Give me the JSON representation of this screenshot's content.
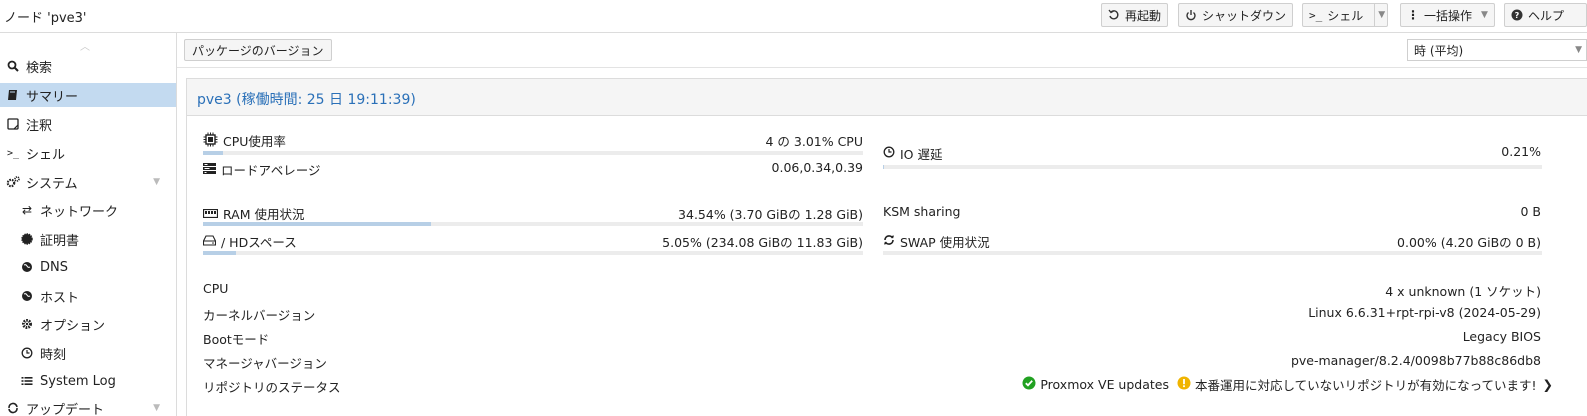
{
  "header": {
    "title": "ノード 'pve3'",
    "buttons": {
      "reboot": "再起動",
      "shutdown": "シャットダウン",
      "shell": "シェル",
      "bulk": "一括操作",
      "help": "ヘルプ"
    }
  },
  "sidebar": {
    "items": [
      {
        "label": "検索",
        "icon": "search-icon"
      },
      {
        "label": "サマリー",
        "icon": "book-icon",
        "active": true
      },
      {
        "label": "注釈",
        "icon": "note-icon"
      },
      {
        "label": "シェル",
        "icon": "terminal-icon"
      },
      {
        "label": "システム",
        "icon": "gears-icon"
      },
      {
        "label": "ネットワーク",
        "icon": "exchange-icon"
      },
      {
        "label": "証明書",
        "icon": "certificate-icon"
      },
      {
        "label": "DNS",
        "icon": "globe-icon"
      },
      {
        "label": "ホスト",
        "icon": "globe-icon"
      },
      {
        "label": "オプション",
        "icon": "gear-icon"
      },
      {
        "label": "時刻",
        "icon": "clock-icon"
      },
      {
        "label": "System Log",
        "icon": "list-icon"
      },
      {
        "label": "アップデート",
        "icon": "refresh-icon"
      }
    ]
  },
  "toolbar": {
    "package_versions": "パッケージのバージョン",
    "timeframe": "時 (平均)"
  },
  "summary": {
    "title": "pve3 (稼働時間: 25 日 19:11:39)",
    "cpu_label": "CPU使用率",
    "cpu_value": "4 の 3.01% CPU",
    "cpu_fraction": 0.0301,
    "load_label": "ロードアベレージ",
    "load_value": "0.06,0.34,0.39",
    "io_label": "IO 遅延",
    "io_value": "0.21%",
    "io_fraction": 0.0021,
    "ram_label": "RAM 使用状況",
    "ram_value": "34.54% (3.70 GiBの 1.28 GiB)",
    "ram_fraction": 0.3454,
    "ksm_label": "KSM sharing",
    "ksm_value": "0 B",
    "hd_label": "/ HDスペース",
    "hd_value": "5.05% (234.08 GiBの 11.83 GiB)",
    "hd_fraction": 0.0505,
    "swap_label": "SWAP 使用状況",
    "swap_value": "0.00% (4.20 GiBの 0 B)",
    "swap_fraction": 0.0,
    "info": [
      {
        "label": "CPU",
        "value": "4 x unknown (1 ソケット)"
      },
      {
        "label": "カーネルバージョン",
        "value": "Linux 6.6.31+rpt-rpi-v8 (2024-05-29)"
      },
      {
        "label": "Bootモード",
        "value": "Legacy BIOS"
      },
      {
        "label": "マネージャバージョン",
        "value": "pve-manager/8.2.4/0098b77b88c86db8"
      }
    ],
    "repo_label": "リポジトリのステータス",
    "repo_ok": "Proxmox VE updates",
    "repo_warn": "本番運用に対応していないリポジトリが有効になっています!"
  },
  "colors": {
    "accent": "#2a70b8",
    "active_bg": "#c3daf0",
    "bar_fill": "#b7cfe6",
    "ok": "#21a121",
    "warn": "#f0b400"
  }
}
